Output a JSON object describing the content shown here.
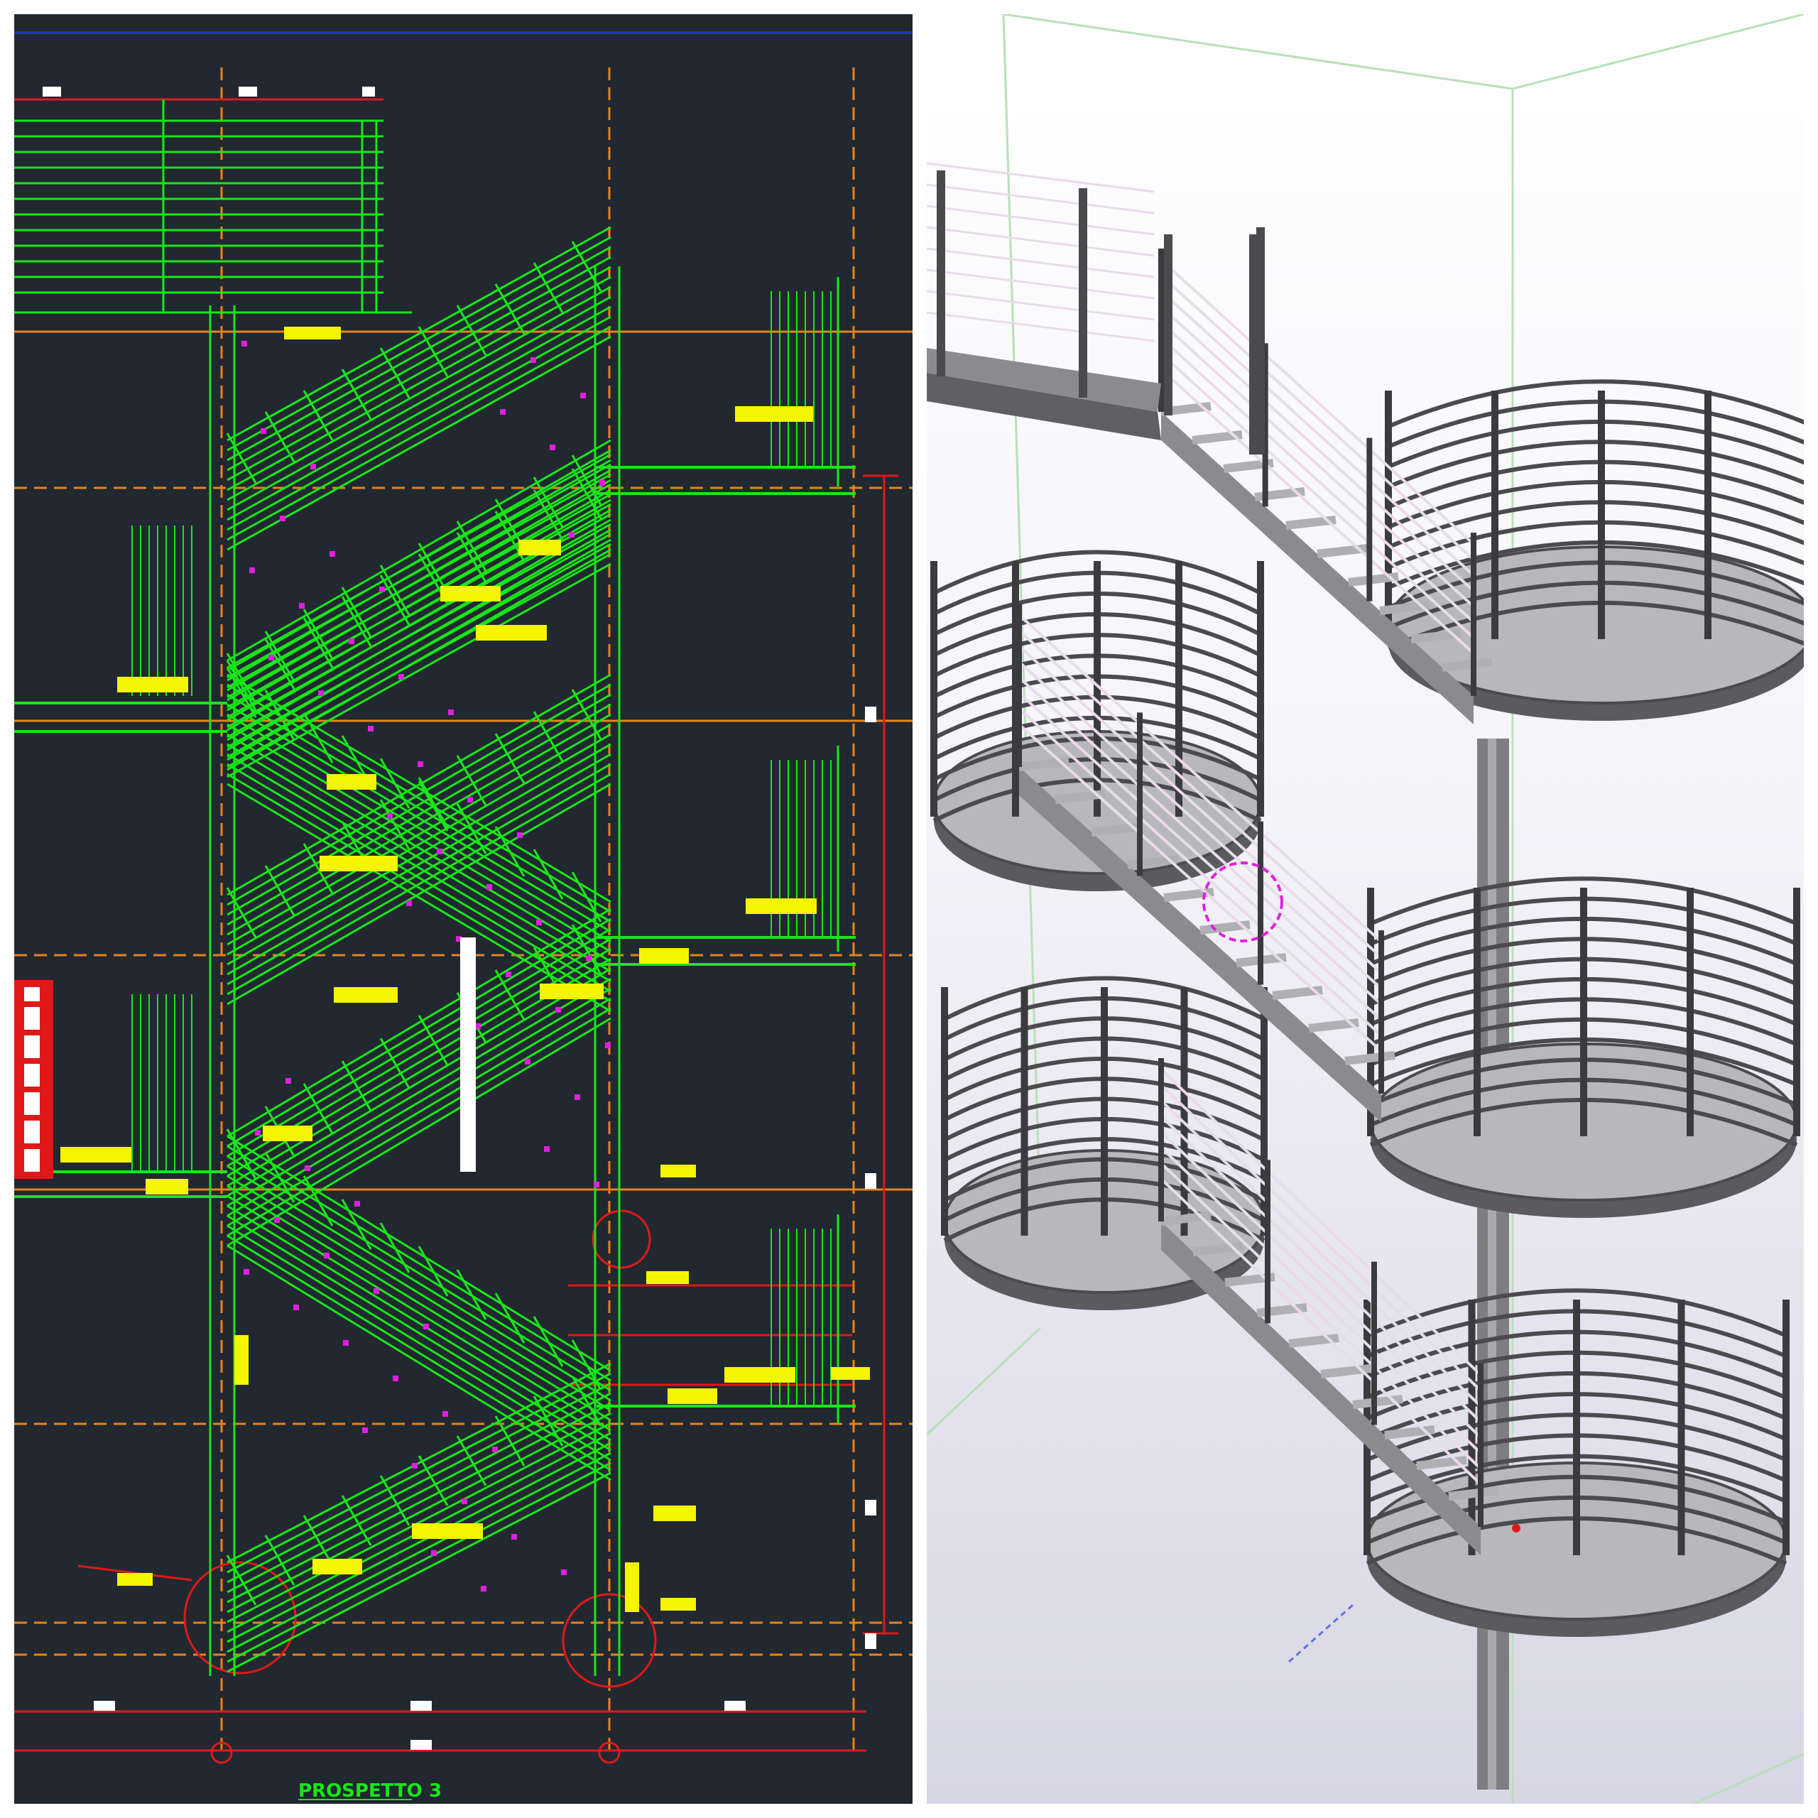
{
  "cad_view": {
    "title": "PROSPETTO 3",
    "colors": {
      "background": "#212830",
      "stair_lines": "#19e619",
      "grid_lines": "#e8821c",
      "dimension_lines": "#e01818",
      "tags": "#f5f500",
      "markers": "#e020e0"
    },
    "floor_count": 4
  },
  "model_view": {
    "colors": {
      "steel": "#7d7d82",
      "rails_light": "#e9dcea",
      "background_bottom": "#d7d6e4"
    },
    "landing_count": 3
  }
}
